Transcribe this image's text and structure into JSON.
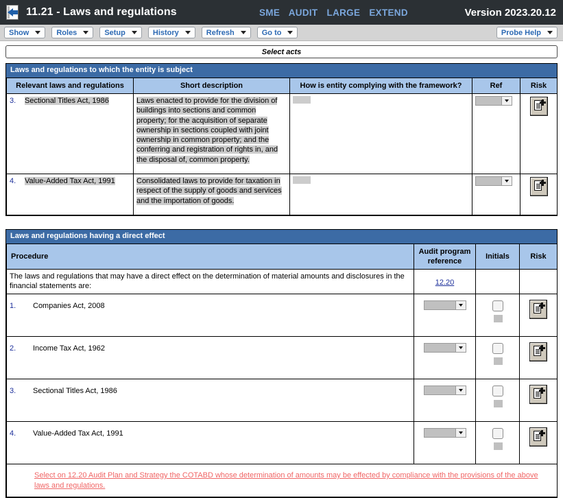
{
  "titlebar": {
    "icon": "back-document-icon",
    "title": "11.21 - Laws and regulations",
    "modes": [
      "SME",
      "AUDIT",
      "LARGE",
      "EXTEND"
    ],
    "version": "Version 2023.20.12"
  },
  "toolbar": {
    "items": [
      {
        "label": "Show"
      },
      {
        "label": "Roles"
      },
      {
        "label": "Setup"
      },
      {
        "label": "History"
      },
      {
        "label": "Refresh"
      },
      {
        "label": "Go to"
      }
    ],
    "help": {
      "label": "Probe Help"
    }
  },
  "select_acts": {
    "label": "Select acts"
  },
  "panel1": {
    "title": "Laws and regulations to which the entity is subject",
    "columns": [
      "Relevant laws and regulations",
      "Short description",
      "How is entity complying with the framework?",
      "Ref",
      "Risk"
    ],
    "rows": [
      {
        "num": "3.",
        "name": "Sectional Titles Act, 1986",
        "description": "Laws enacted to provide for the division of buildings into sections and common property; for the acquisition of separate ownership in sections coupled with joint ownership in common property; and the conferring and registration of rights in, and the disposal of, common property.",
        "complying": "",
        "ref": "",
        "risk_icon": "document-add-icon"
      },
      {
        "num": "4.",
        "name": "Value-Added Tax Act, 1991",
        "description": "Consolidated laws to provide for taxation in respect of the supply of goods and services and the importation of goods.",
        "complying": "",
        "ref": "",
        "risk_icon": "document-add-icon"
      }
    ]
  },
  "panel2": {
    "title": "Laws and regulations having a direct effect",
    "columns": [
      "Procedure",
      "Audit program reference",
      "Initials",
      "Risk"
    ],
    "intro": {
      "text": "The laws and regulations that may have a direct effect on the determination of material amounts and disclosures in the financial statements are:",
      "reference": "12.20"
    },
    "rows": [
      {
        "num": "1.",
        "label": "Companies Act, 2008",
        "reference": "",
        "initials": "",
        "risk_icon": "document-add-icon"
      },
      {
        "num": "2.",
        "label": "Income Tax Act, 1962",
        "reference": "",
        "initials": "",
        "risk_icon": "document-add-icon"
      },
      {
        "num": "3.",
        "label": "Sectional Titles Act, 1986",
        "reference": "",
        "initials": "",
        "risk_icon": "document-add-icon"
      },
      {
        "num": "4.",
        "label": "Value-Added Tax Act, 1991",
        "reference": "",
        "initials": "",
        "risk_icon": "document-add-icon"
      }
    ],
    "note": "Select on 12.20 Audit Plan and Strategy the COTABD whose determination of amounts may be effected by compliance with the provisions of the above laws and regulations."
  },
  "colors": {
    "titlebar_bg": "#2b3034",
    "mode_text": "#7ba7dd",
    "panel_header": "#3c6ba5",
    "column_header": "#a8c6ea",
    "link": "#1b2e9a",
    "note": "#f06565",
    "field_fill": "#cccccc"
  }
}
